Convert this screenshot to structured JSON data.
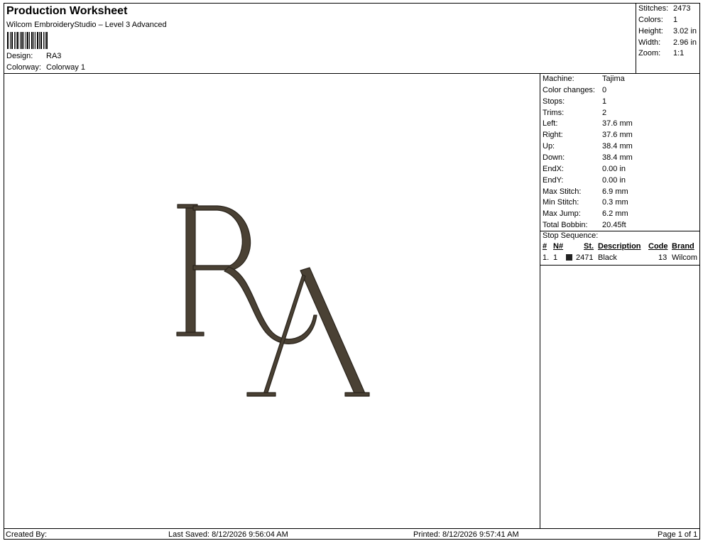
{
  "header": {
    "title": "Production Worksheet",
    "subtitle": "Wilcom EmbroideryStudio – Level 3 Advanced",
    "design_label": "Design:",
    "design_value": "RA3",
    "colorway_label": "Colorway:",
    "colorway_value": "Colorway 1"
  },
  "stats": [
    {
      "label": "Stitches:",
      "value": "2473"
    },
    {
      "label": "Colors:",
      "value": "1"
    },
    {
      "label": "Height:",
      "value": "3.02 in"
    },
    {
      "label": "Width:",
      "value": "2.96 in"
    },
    {
      "label": "Zoom:",
      "value": "1:1"
    }
  ],
  "machine_info": [
    {
      "label": "Machine:",
      "value": "Tajima"
    },
    {
      "label": "Color changes:",
      "value": "0"
    },
    {
      "label": "Stops:",
      "value": "1"
    },
    {
      "label": "Trims:",
      "value": "2"
    },
    {
      "label": "Left:",
      "value": "37.6 mm"
    },
    {
      "label": "Right:",
      "value": "37.6 mm"
    },
    {
      "label": "Up:",
      "value": "38.4 mm"
    },
    {
      "label": "Down:",
      "value": "38.4 mm"
    },
    {
      "label": "EndX:",
      "value": "0.00 in"
    },
    {
      "label": "EndY:",
      "value": "0.00 in"
    },
    {
      "label": "Max Stitch:",
      "value": "6.9 mm"
    },
    {
      "label": "Min Stitch:",
      "value": "0.3 mm"
    },
    {
      "label": "Max Jump:",
      "value": "6.2 mm"
    },
    {
      "label": "Total Bobbin:",
      "value": "20.45ft"
    }
  ],
  "stop_sequence": {
    "title": "Stop Sequence:",
    "headers": {
      "num": "#",
      "needle": "N#",
      "stitches": "St.",
      "description": "Description",
      "code": "Code",
      "brand": "Brand"
    },
    "rows": [
      {
        "num": "1.",
        "needle": "1",
        "stitches": "2471",
        "description": "Black",
        "code": "13",
        "brand": "Wilcom",
        "color": "#222222"
      }
    ]
  },
  "design_colors": {
    "thread": "#4a4134",
    "outline": "#2a241c"
  },
  "footer": {
    "created_by": "Created By:",
    "last_saved": "Last Saved: 8/12/2026 9:56:04 AM",
    "printed": "Printed: 8/12/2026 9:57:41 AM",
    "page": "Page 1 of 1"
  }
}
